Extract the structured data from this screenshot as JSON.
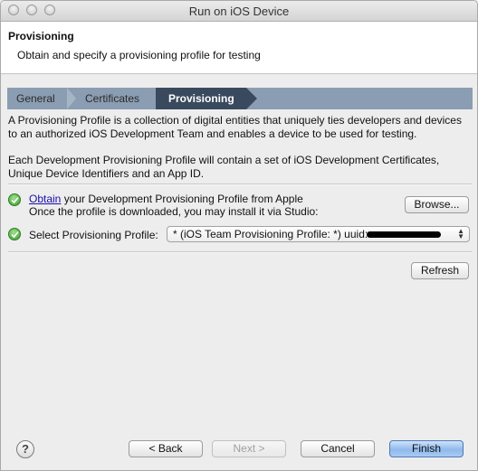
{
  "window": {
    "title": "Run on iOS Device"
  },
  "banner": {
    "title": "Provisioning",
    "description": "Obtain and specify a provisioning profile for testing"
  },
  "breadcrumbs": [
    {
      "label": "General",
      "active": false
    },
    {
      "label": "Certificates",
      "active": false
    },
    {
      "label": "Provisioning",
      "active": true
    }
  ],
  "intro": {
    "line1": "A Provisioning Profile is a collection of digital entities that uniquely ties developers and devices to an authorized iOS Development Team and enables a device to be used for testing.",
    "line2": "Each Development Provisioning Profile will contain a set of iOS Development Certificates, Unique Device Identifiers and an App ID."
  },
  "obtain": {
    "link": "Obtain",
    "text": " your Development Provisioning Profile from Apple",
    "subtext": "Once the profile is downloaded, you may install it via Studio:",
    "browse_label": "Browse..."
  },
  "profile": {
    "label": "Select Provisioning Profile:",
    "selected": "* (iOS Team Provisioning Profile: *) uuid:"
  },
  "refresh_label": "Refresh",
  "footer": {
    "help": "?",
    "back": "< Back",
    "next": "Next >",
    "cancel": "Cancel",
    "finish": "Finish"
  },
  "colors": {
    "breadcrumb_bar": "#8a9db2",
    "breadcrumb_active": "#3a4a5e",
    "link": "#1a0dab",
    "check": "#3d9a2e"
  }
}
